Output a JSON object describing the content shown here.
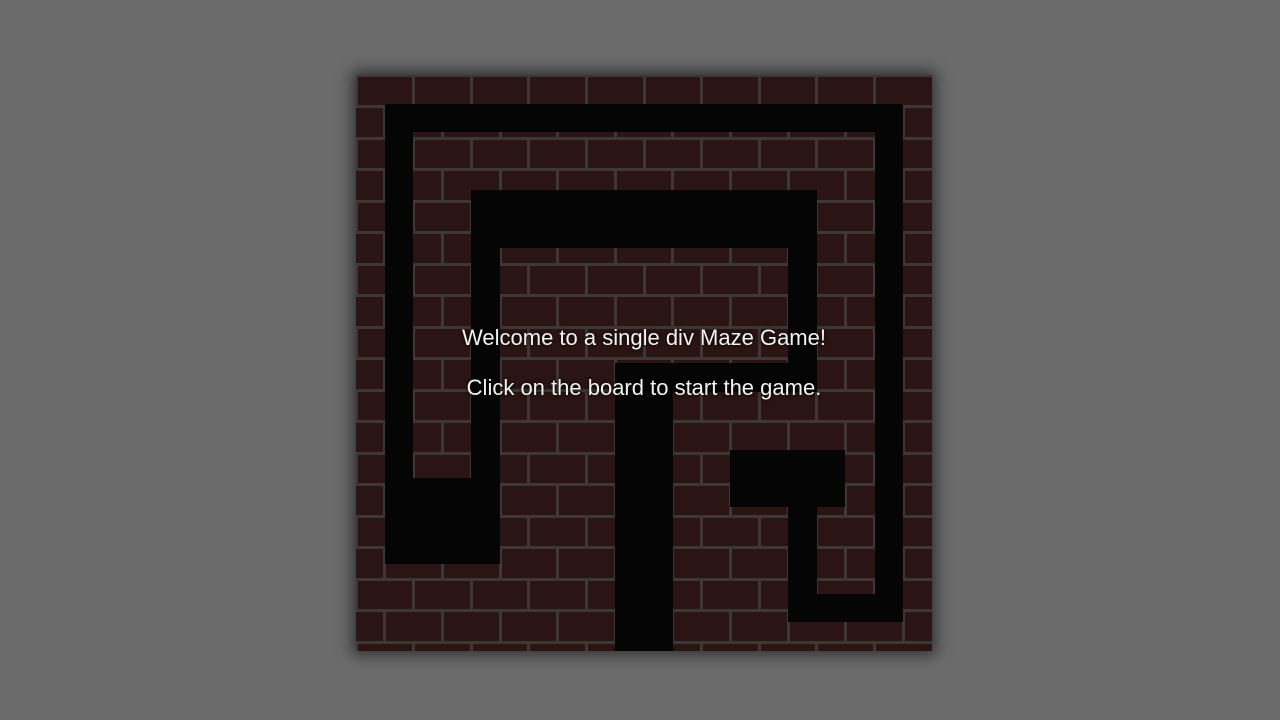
{
  "game": {
    "welcome_text": "Welcome to a single div Maze Game!",
    "instruction_text": "Click on the board to start the game."
  },
  "colors": {
    "background": "#6b6b6b",
    "brick": "#2a1414",
    "mortar": "#3d3836",
    "wall": "#050505",
    "text": "#f2f2f2"
  }
}
